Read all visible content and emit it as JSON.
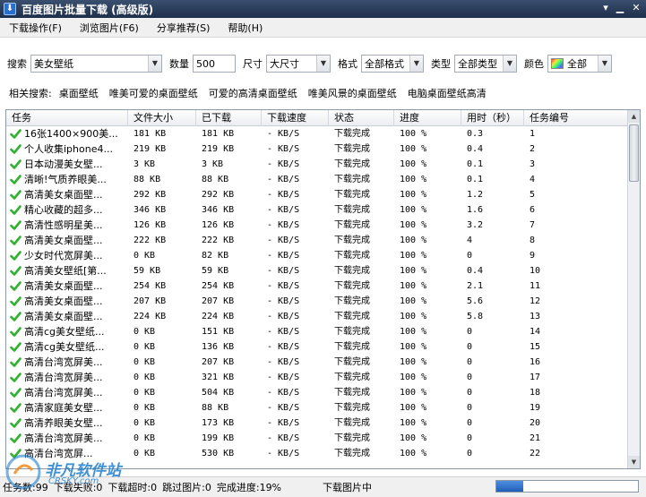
{
  "window": {
    "title": "百度图片批量下载 (高级版)"
  },
  "menu": [
    {
      "label": "下载操作(F)"
    },
    {
      "label": "浏览图片(F6)"
    },
    {
      "label": "分享推荐(S)"
    },
    {
      "label": "帮助(H)"
    }
  ],
  "toolbar": {
    "search_label": "搜索",
    "search_value": "美女壁纸",
    "count_label": "数量",
    "count_value": "500",
    "size_label": "尺寸",
    "size_value": "大尺寸",
    "format_label": "格式",
    "format_value": "全部格式",
    "type_label": "类型",
    "type_value": "全部类型",
    "color_label": "颜色",
    "color_value": "全部"
  },
  "related": {
    "label": "相关搜索:",
    "tags": [
      "桌面壁纸",
      "唯美可爱的桌面壁纸",
      "可爱的高清桌面壁纸",
      "唯美风景的桌面壁纸",
      "电脑桌面壁纸高清"
    ]
  },
  "table": {
    "columns": [
      "任务",
      "文件大小",
      "已下载",
      "下载速度",
      "状态",
      "进度",
      "用时（秒）",
      "任务编号"
    ],
    "rows": [
      [
        "16张1400×900美...",
        "181 KB",
        "181 KB",
        "- KB/S",
        "下载完成",
        "100 %",
        "0.3",
        "1"
      ],
      [
        "个人收集iphone4...",
        "219 KB",
        "219 KB",
        "- KB/S",
        "下载完成",
        "100 %",
        "0.4",
        "2"
      ],
      [
        "日本动漫美女壁...",
        "3 KB",
        "3 KB",
        "- KB/S",
        "下载完成",
        "100 %",
        "0.1",
        "3"
      ],
      [
        "清晰!气质养眼美...",
        "88 KB",
        "88 KB",
        "- KB/S",
        "下载完成",
        "100 %",
        "0.1",
        "4"
      ],
      [
        "高清美女桌面壁...",
        "292 KB",
        "292 KB",
        "- KB/S",
        "下载完成",
        "100 %",
        "1.2",
        "5"
      ],
      [
        "精心收藏的超多...",
        "346 KB",
        "346 KB",
        "- KB/S",
        "下载完成",
        "100 %",
        "1.6",
        "6"
      ],
      [
        "高清性感明星美...",
        "126 KB",
        "126 KB",
        "- KB/S",
        "下载完成",
        "100 %",
        "3.2",
        "7"
      ],
      [
        "高清美女桌面壁...",
        "222 KB",
        "222 KB",
        "- KB/S",
        "下载完成",
        "100 %",
        "4",
        "8"
      ],
      [
        "少女时代宽屏美...",
        "0 KB",
        "82 KB",
        "- KB/S",
        "下载完成",
        "100 %",
        "0",
        "9"
      ],
      [
        "高清美女壁纸[第...",
        "59 KB",
        "59 KB",
        "- KB/S",
        "下载完成",
        "100 %",
        "0.4",
        "10"
      ],
      [
        "高清美女桌面壁...",
        "254 KB",
        "254 KB",
        "- KB/S",
        "下载完成",
        "100 %",
        "2.1",
        "11"
      ],
      [
        "高清美女桌面壁...",
        "207 KB",
        "207 KB",
        "- KB/S",
        "下载完成",
        "100 %",
        "5.6",
        "12"
      ],
      [
        "高清美女桌面壁...",
        "224 KB",
        "224 KB",
        "- KB/S",
        "下载完成",
        "100 %",
        "5.8",
        "13"
      ],
      [
        "高清cg美女壁纸...",
        "0 KB",
        "151 KB",
        "- KB/S",
        "下载完成",
        "100 %",
        "0",
        "14"
      ],
      [
        "高清cg美女壁纸...",
        "0 KB",
        "136 KB",
        "- KB/S",
        "下载完成",
        "100 %",
        "0",
        "15"
      ],
      [
        "高清台湾宽屏美...",
        "0 KB",
        "207 KB",
        "- KB/S",
        "下载完成",
        "100 %",
        "0",
        "16"
      ],
      [
        "高清台湾宽屏美...",
        "0 KB",
        "321 KB",
        "- KB/S",
        "下载完成",
        "100 %",
        "0",
        "17"
      ],
      [
        "高清台湾宽屏美...",
        "0 KB",
        "504 KB",
        "- KB/S",
        "下载完成",
        "100 %",
        "0",
        "18"
      ],
      [
        "高清家庭美女壁...",
        "0 KB",
        "88 KB",
        "- KB/S",
        "下载完成",
        "100 %",
        "0",
        "19"
      ],
      [
        "高清养眼美女壁...",
        "0 KB",
        "173 KB",
        "- KB/S",
        "下载完成",
        "100 %",
        "0",
        "20"
      ],
      [
        "高清台湾宽屏美...",
        "0 KB",
        "199 KB",
        "- KB/S",
        "下载完成",
        "100 %",
        "0",
        "21"
      ],
      [
        "高清台湾宽屏...",
        "0 KB",
        "530 KB",
        "- KB/S",
        "下载完成",
        "100 %",
        "0",
        "22"
      ]
    ]
  },
  "status": {
    "total": "任务数:99",
    "failed": "下载失败:0",
    "timeout": "下载超时:0",
    "skipped": "跳过图片:0",
    "completion": "完成进度:19%",
    "state": "下载图片中",
    "progress_fraction": 0.19
  },
  "watermark": {
    "text": "非凡软件站",
    "sub": "CRSKY.com"
  },
  "colors": {
    "titlebar": "#1e2f4a",
    "check": "#2fb12f",
    "progress": "#1f5fb8",
    "watermark": "#1e7fd0"
  },
  "icons": {
    "task_status": "check-icon",
    "app": "download-icon",
    "dropdown": "chevron-down-icon"
  }
}
